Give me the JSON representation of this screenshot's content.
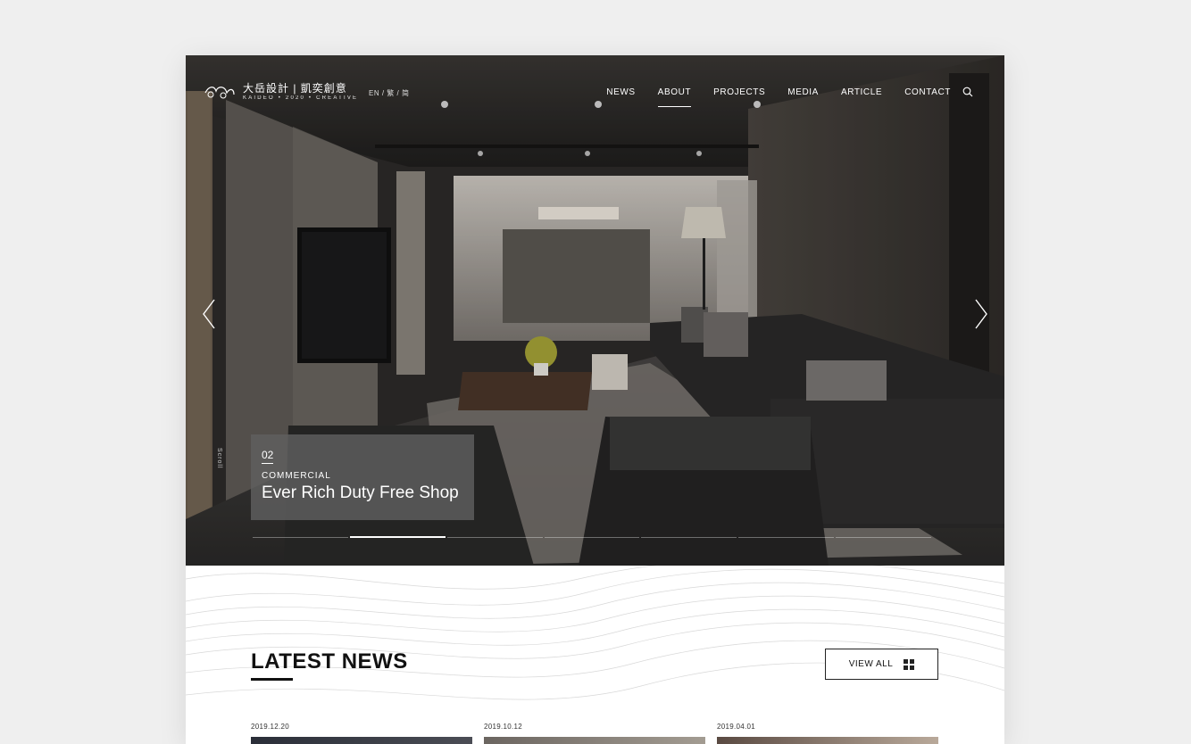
{
  "header": {
    "logo_zh": "大岳設計 | 凱奕創意",
    "logo_sub": "KAIDEO • 2020 • CREATIVE",
    "lang": "EN / 繁 / 简",
    "nav": [
      "NEWS",
      "ABOUT",
      "PROJECTS",
      "MEDIA",
      "ARTICLE",
      "CONTACT"
    ],
    "active_nav": "ABOUT"
  },
  "hero": {
    "scroll_label": "Scroll",
    "slide_number": "02",
    "category": "COMMERCIAL",
    "title": "Ever Rich Duty Free Shop",
    "progress": {
      "total": 7,
      "active_index": 1
    }
  },
  "news": {
    "title": "LATEST NEWS",
    "view_all": "VIEW ALL",
    "items": [
      {
        "date": "2019.12.20"
      },
      {
        "date": "2019.10.12"
      },
      {
        "date": "2019.04.01"
      }
    ]
  },
  "icons": {
    "search": "search-icon",
    "prev": "chevron-left-icon",
    "next": "chevron-right-icon",
    "view_all": "grid-icon"
  },
  "colors": {
    "accent": "#111111",
    "hero_caption_bg": "#5f5f5f"
  }
}
